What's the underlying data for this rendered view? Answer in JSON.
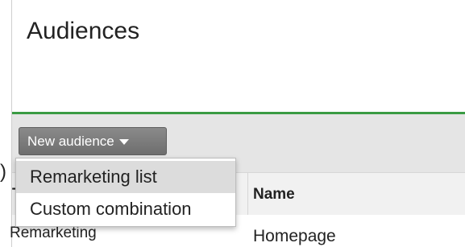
{
  "panel": {
    "title": "Audiences"
  },
  "toolbar": {
    "new_audience_label": "New audience",
    "new_audience_icon": "caret-down-icon"
  },
  "dropdown": {
    "items": [
      "Remarketing list",
      "Custom combination"
    ]
  },
  "table": {
    "columns": [
      "T",
      "Name"
    ],
    "rows": [
      {
        "type": "Remarketing",
        "name": "Homepage"
      }
    ]
  },
  "left_edge_fragment": ")",
  "colors": {
    "accent_green": "#3a9b43",
    "button_gray": "#7a7a7a"
  }
}
